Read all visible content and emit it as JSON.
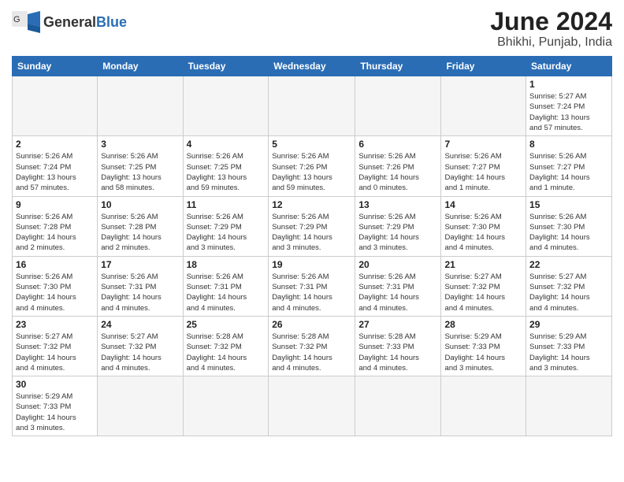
{
  "header": {
    "logo_general": "General",
    "logo_blue": "Blue",
    "title": "June 2024",
    "location": "Bhikhi, Punjab, India"
  },
  "weekdays": [
    "Sunday",
    "Monday",
    "Tuesday",
    "Wednesday",
    "Thursday",
    "Friday",
    "Saturday"
  ],
  "weeks": [
    [
      {
        "day": "",
        "info": ""
      },
      {
        "day": "",
        "info": ""
      },
      {
        "day": "",
        "info": ""
      },
      {
        "day": "",
        "info": ""
      },
      {
        "day": "",
        "info": ""
      },
      {
        "day": "",
        "info": ""
      },
      {
        "day": "1",
        "info": "Sunrise: 5:27 AM\nSunset: 7:24 PM\nDaylight: 13 hours\nand 57 minutes."
      }
    ],
    [
      {
        "day": "2",
        "info": "Sunrise: 5:26 AM\nSunset: 7:24 PM\nDaylight: 13 hours\nand 57 minutes."
      },
      {
        "day": "3",
        "info": "Sunrise: 5:26 AM\nSunset: 7:25 PM\nDaylight: 13 hours\nand 58 minutes."
      },
      {
        "day": "4",
        "info": "Sunrise: 5:26 AM\nSunset: 7:25 PM\nDaylight: 13 hours\nand 59 minutes."
      },
      {
        "day": "5",
        "info": "Sunrise: 5:26 AM\nSunset: 7:26 PM\nDaylight: 13 hours\nand 59 minutes."
      },
      {
        "day": "6",
        "info": "Sunrise: 5:26 AM\nSunset: 7:26 PM\nDaylight: 14 hours\nand 0 minutes."
      },
      {
        "day": "7",
        "info": "Sunrise: 5:26 AM\nSunset: 7:27 PM\nDaylight: 14 hours\nand 1 minute."
      },
      {
        "day": "8",
        "info": "Sunrise: 5:26 AM\nSunset: 7:27 PM\nDaylight: 14 hours\nand 1 minute."
      }
    ],
    [
      {
        "day": "9",
        "info": "Sunrise: 5:26 AM\nSunset: 7:28 PM\nDaylight: 14 hours\nand 2 minutes."
      },
      {
        "day": "10",
        "info": "Sunrise: 5:26 AM\nSunset: 7:28 PM\nDaylight: 14 hours\nand 2 minutes."
      },
      {
        "day": "11",
        "info": "Sunrise: 5:26 AM\nSunset: 7:29 PM\nDaylight: 14 hours\nand 3 minutes."
      },
      {
        "day": "12",
        "info": "Sunrise: 5:26 AM\nSunset: 7:29 PM\nDaylight: 14 hours\nand 3 minutes."
      },
      {
        "day": "13",
        "info": "Sunrise: 5:26 AM\nSunset: 7:29 PM\nDaylight: 14 hours\nand 3 minutes."
      },
      {
        "day": "14",
        "info": "Sunrise: 5:26 AM\nSunset: 7:30 PM\nDaylight: 14 hours\nand 4 minutes."
      },
      {
        "day": "15",
        "info": "Sunrise: 5:26 AM\nSunset: 7:30 PM\nDaylight: 14 hours\nand 4 minutes."
      }
    ],
    [
      {
        "day": "16",
        "info": "Sunrise: 5:26 AM\nSunset: 7:30 PM\nDaylight: 14 hours\nand 4 minutes."
      },
      {
        "day": "17",
        "info": "Sunrise: 5:26 AM\nSunset: 7:31 PM\nDaylight: 14 hours\nand 4 minutes."
      },
      {
        "day": "18",
        "info": "Sunrise: 5:26 AM\nSunset: 7:31 PM\nDaylight: 14 hours\nand 4 minutes."
      },
      {
        "day": "19",
        "info": "Sunrise: 5:26 AM\nSunset: 7:31 PM\nDaylight: 14 hours\nand 4 minutes."
      },
      {
        "day": "20",
        "info": "Sunrise: 5:26 AM\nSunset: 7:31 PM\nDaylight: 14 hours\nand 4 minutes."
      },
      {
        "day": "21",
        "info": "Sunrise: 5:27 AM\nSunset: 7:32 PM\nDaylight: 14 hours\nand 4 minutes."
      },
      {
        "day": "22",
        "info": "Sunrise: 5:27 AM\nSunset: 7:32 PM\nDaylight: 14 hours\nand 4 minutes."
      }
    ],
    [
      {
        "day": "23",
        "info": "Sunrise: 5:27 AM\nSunset: 7:32 PM\nDaylight: 14 hours\nand 4 minutes."
      },
      {
        "day": "24",
        "info": "Sunrise: 5:27 AM\nSunset: 7:32 PM\nDaylight: 14 hours\nand 4 minutes."
      },
      {
        "day": "25",
        "info": "Sunrise: 5:28 AM\nSunset: 7:32 PM\nDaylight: 14 hours\nand 4 minutes."
      },
      {
        "day": "26",
        "info": "Sunrise: 5:28 AM\nSunset: 7:32 PM\nDaylight: 14 hours\nand 4 minutes."
      },
      {
        "day": "27",
        "info": "Sunrise: 5:28 AM\nSunset: 7:33 PM\nDaylight: 14 hours\nand 4 minutes."
      },
      {
        "day": "28",
        "info": "Sunrise: 5:29 AM\nSunset: 7:33 PM\nDaylight: 14 hours\nand 3 minutes."
      },
      {
        "day": "29",
        "info": "Sunrise: 5:29 AM\nSunset: 7:33 PM\nDaylight: 14 hours\nand 3 minutes."
      }
    ],
    [
      {
        "day": "30",
        "info": "Sunrise: 5:29 AM\nSunset: 7:33 PM\nDaylight: 14 hours\nand 3 minutes."
      },
      {
        "day": "",
        "info": ""
      },
      {
        "day": "",
        "info": ""
      },
      {
        "day": "",
        "info": ""
      },
      {
        "day": "",
        "info": ""
      },
      {
        "day": "",
        "info": ""
      },
      {
        "day": "",
        "info": ""
      }
    ]
  ]
}
